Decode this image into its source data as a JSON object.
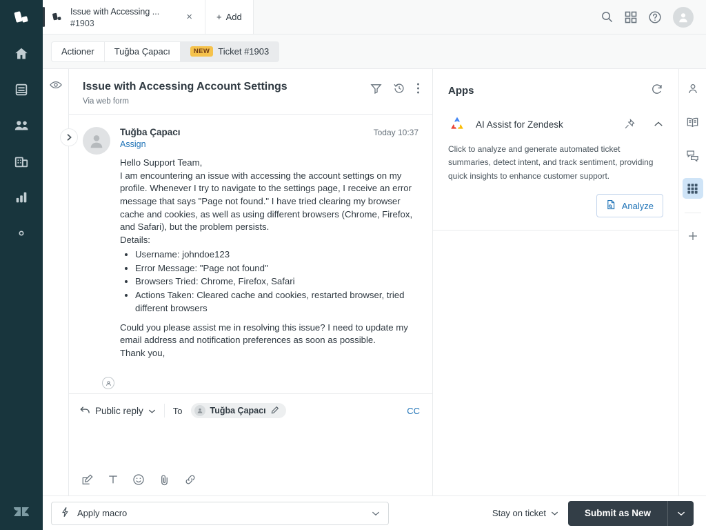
{
  "brand": {
    "rail_bg": "#18353d",
    "accent_blue": "#1f73b7",
    "badge_amber": "#f5c24c",
    "submit_dark": "#333e47"
  },
  "left_rail": {
    "logo_name": "actioner-logo",
    "items": [
      {
        "name": "home-icon",
        "label": "Home"
      },
      {
        "name": "views-icon",
        "label": "Views"
      },
      {
        "name": "customers-icon",
        "label": "Customers"
      },
      {
        "name": "organizations-icon",
        "label": "Organizations"
      },
      {
        "name": "reporting-icon",
        "label": "Reporting"
      },
      {
        "name": "admin-gear-icon",
        "label": "Admin"
      }
    ],
    "bottom_logo_name": "zendesk-logo"
  },
  "topbar": {
    "tab": {
      "icon_name": "ticket-tab-icon",
      "title": "Issue with Accessing ...",
      "subtitle": "#1903",
      "close_label": "×"
    },
    "add_label": "Add",
    "add_plus": "+",
    "actions": [
      {
        "name": "search-icon",
        "label": "Search"
      },
      {
        "name": "apps-grid-icon",
        "label": "Products"
      },
      {
        "name": "help-icon",
        "label": "Help"
      },
      {
        "name": "avatar",
        "label": "Profile"
      }
    ]
  },
  "breadcrumb": {
    "items": [
      {
        "label": "Actioner",
        "active": false,
        "badge": ""
      },
      {
        "label": "Tuğba Çapacı",
        "active": false,
        "badge": ""
      },
      {
        "label": "Ticket #1903",
        "active": true,
        "badge": "NEW"
      }
    ]
  },
  "ticket": {
    "title": "Issue with Accessing Account Settings",
    "via": "Via web form",
    "head_icons": [
      {
        "name": "filter-icon"
      },
      {
        "name": "history-icon"
      },
      {
        "name": "more-options-icon"
      }
    ],
    "message": {
      "author": "Tuğba Çapacı",
      "time": "Today 10:37",
      "assign_label": "Assign",
      "greeting": "Hello Support Team,",
      "paragraph_1": "I am encountering an issue with accessing the account settings on my profile. Whenever I try to navigate to the settings page, I receive an error message that says \"Page not found.\" I have tried clearing my browser cache and cookies, as well as using different browsers (Chrome, Firefox, and Safari), but the problem persists.",
      "details_label": "Details:",
      "details": [
        "Username: johndoe123",
        "Error Message: \"Page not found\"",
        "Browsers Tried: Chrome, Firefox, Safari",
        "Actions Taken: Cleared cache and cookies, restarted browser, tried different browsers"
      ],
      "paragraph_2": "Could you please assist me in resolving this issue? I need to update my email address and notification preferences as soon as possible.",
      "closing": "Thank you,"
    }
  },
  "composer": {
    "reply_type": "Public reply",
    "to_label": "To",
    "recipient": "Tuğba Çapacı",
    "cc_label": "CC",
    "tools": [
      {
        "name": "compose-icon"
      },
      {
        "name": "text-format-icon"
      },
      {
        "name": "emoji-icon"
      },
      {
        "name": "attachment-icon"
      },
      {
        "name": "link-icon"
      }
    ]
  },
  "apps": {
    "title": "Apps",
    "refresh_name": "refresh-icon",
    "card": {
      "logo_name": "ai-assist-logo",
      "name": "AI Assist for Zendesk",
      "pin_name": "pin-icon",
      "collapse_name": "chevron-up-icon",
      "description": "Click to analyze and generate automated ticket summaries, detect intent, and track sentiment, providing quick insights to enhance customer support.",
      "analyze_label": "Analyze",
      "analyze_icon_name": "document-scan-icon"
    }
  },
  "right_rail": {
    "items": [
      {
        "name": "customer-context-icon",
        "active": false
      },
      {
        "name": "knowledge-icon",
        "active": false
      },
      {
        "name": "conversations-icon",
        "active": false
      },
      {
        "name": "apps-panel-icon",
        "active": true
      }
    ],
    "add_label": "+"
  },
  "bottombar": {
    "macro_placeholder": "Apply macro",
    "macro_icon_name": "macro-bolt-icon",
    "stay_on_ticket": "Stay on ticket",
    "submit_label": "Submit as New"
  }
}
